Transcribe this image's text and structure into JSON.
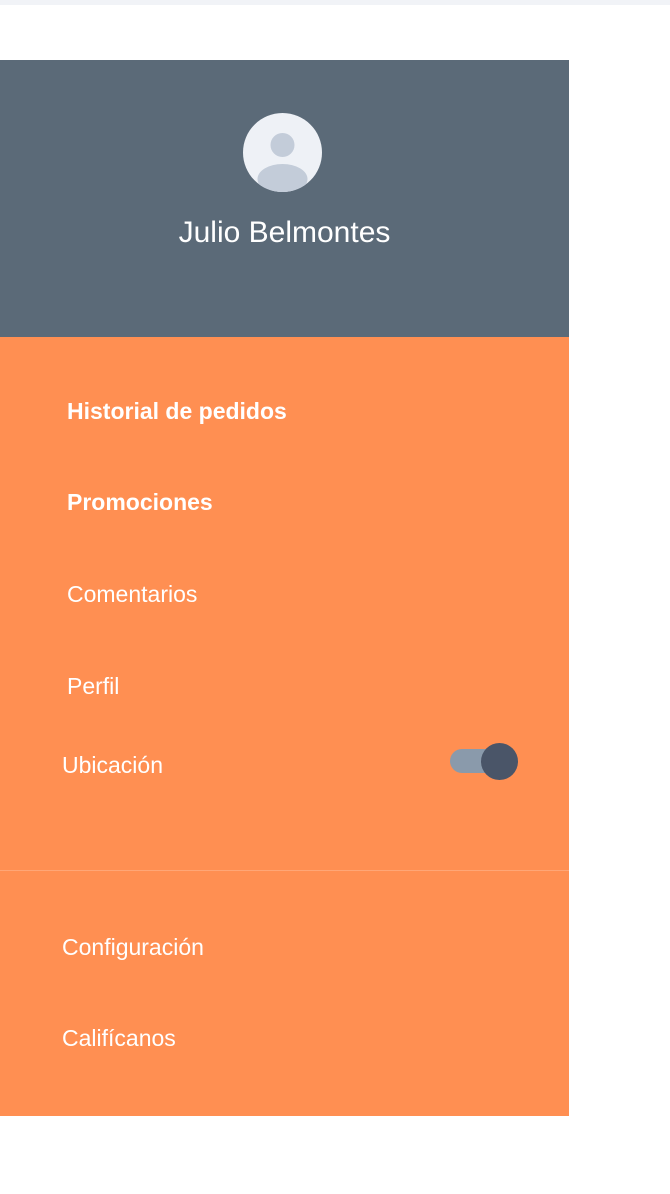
{
  "header": {
    "user_name": "Julio Belmontes",
    "avatar_icon": "user-avatar-icon",
    "background_color": "#5b6a78"
  },
  "menu": {
    "background_color": "#ff8f52",
    "items": [
      {
        "label": "Historial de pedidos",
        "bold": true
      },
      {
        "label": "Promociones",
        "bold": true
      },
      {
        "label": "Comentarios",
        "bold": false
      },
      {
        "label": "Perfil",
        "bold": false
      }
    ],
    "location": {
      "label": "Ubicación",
      "toggle_on": true
    },
    "secondary_items": [
      {
        "label": "Configuración"
      },
      {
        "label": "Califícanos"
      }
    ]
  }
}
